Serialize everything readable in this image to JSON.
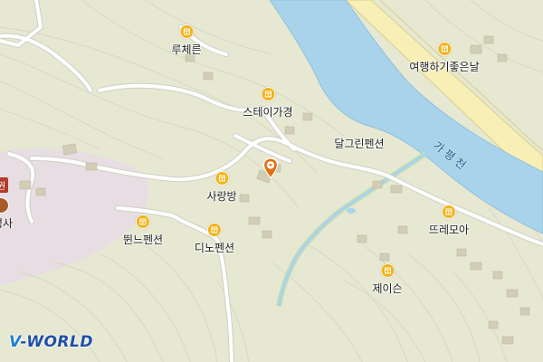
{
  "map": {
    "colors": {
      "land": "#e6e8d2",
      "river": "#a9d3ea",
      "river_edge": "#8fc0dd",
      "road": "#ffffff",
      "road_edge": "#cfcfc4",
      "highway_fill": "#f7efb5",
      "highway_edge": "#d8cf8c",
      "contour": "#d9dbc3",
      "temple_area": "#e7dde3",
      "building": "#d2cdb6",
      "stream": "#a9d3ea",
      "vegetation_edge": "#c5dcb6",
      "poi_icon": "#f2b318",
      "marker": "#e36f15"
    },
    "pois": [
      {
        "name": "루체른",
        "icon": "pension-icon"
      },
      {
        "name": "스테이가경",
        "icon": "pension-icon"
      },
      {
        "name": "여행하기좋은날",
        "icon": "pension-icon"
      },
      {
        "name": "달그린펜션",
        "icon": "pension-icon"
      },
      {
        "name": "사랑방",
        "icon": "pension-icon"
      },
      {
        "name": "뛴느펜션",
        "icon": "pension-icon"
      },
      {
        "name": "디노펜션",
        "icon": "pension-icon"
      },
      {
        "name": "뜨레모아",
        "icon": "pension-icon"
      },
      {
        "name": "제이슨",
        "icon": "pension-icon"
      }
    ],
    "river_label": "가평천",
    "temple_label": "성사",
    "temple_badge": "권",
    "location_marker": "location-pin-icon",
    "logo": {
      "prefix": "V",
      "rest": "-WORLD"
    }
  }
}
